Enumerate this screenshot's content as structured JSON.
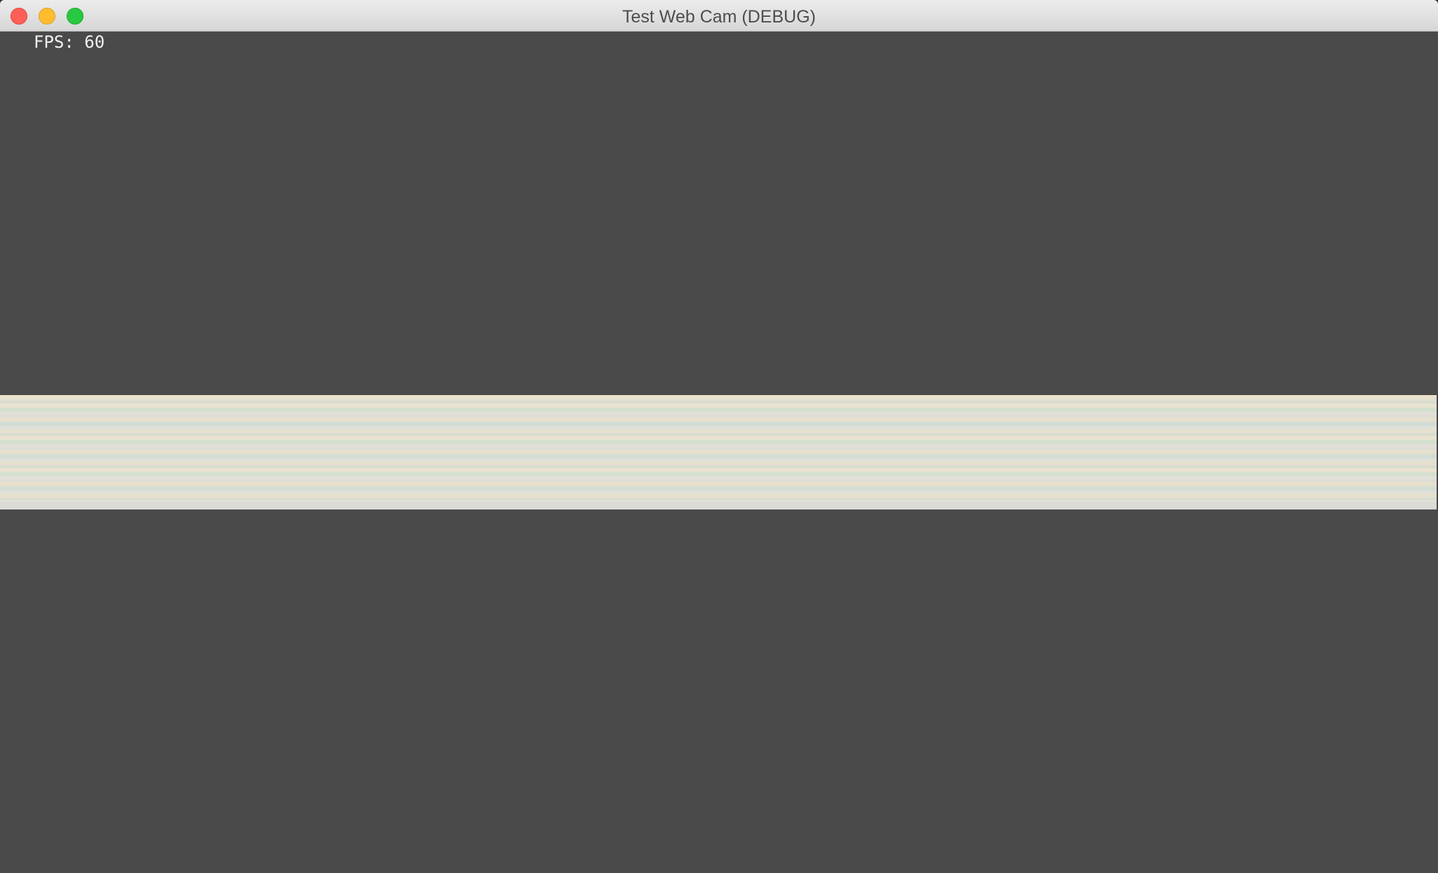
{
  "window": {
    "title": "Test Web Cam (DEBUG)",
    "controls": {
      "close_icon": "close-icon",
      "minimize_icon": "minimize-icon",
      "maximize_icon": "maximize-icon"
    }
  },
  "overlay": {
    "fps_text": "FPS: 60"
  },
  "colors": {
    "background": "#4a4a4a",
    "close": "#fe5f57",
    "minimize": "#febc2e",
    "maximize": "#28c840",
    "fps_text": "#f2f2f2"
  }
}
